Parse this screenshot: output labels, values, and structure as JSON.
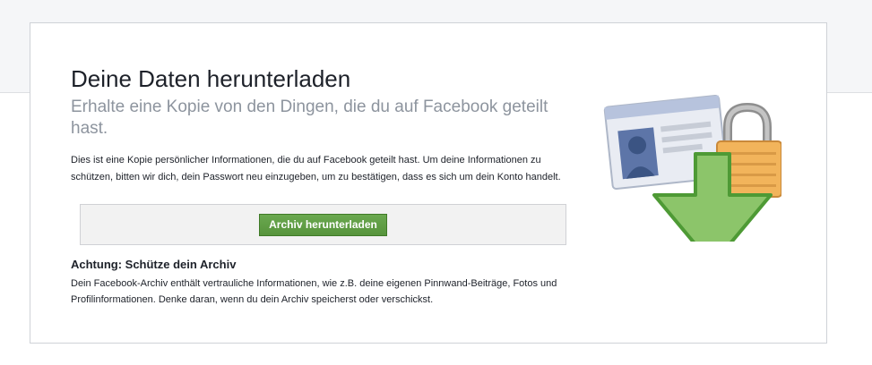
{
  "header": {
    "title": "Deine Daten herunterladen",
    "subtitle": "Erhalte eine Kopie von den Dingen, die du auf Facebook geteilt hast."
  },
  "description": "Dies ist eine Kopie persönlicher Informationen, die du auf Facebook geteilt hast. Um deine Informationen zu schützen, bitten wir dich, dein Passwort neu einzugeben, um zu bestätigen, dass es sich um dein Konto handelt.",
  "download": {
    "button_label": "Archiv herunterladen"
  },
  "warning": {
    "heading": "Achtung: Schütze dein Archiv",
    "text": "Dein Facebook-Archiv enthält vertrauliche Informationen, wie z.B. deine eigenen Pinnwand-Beiträge, Fotos und Profilinformationen. Denke daran, wenn du dein Archiv speicherst oder verschickst."
  },
  "illustration": {
    "icons": [
      "id-card-icon",
      "padlock-icon",
      "download-arrow-icon"
    ]
  },
  "colors": {
    "button": "#5b9a41",
    "arrow": "#8cc56a",
    "lock": "#f2b45b"
  }
}
